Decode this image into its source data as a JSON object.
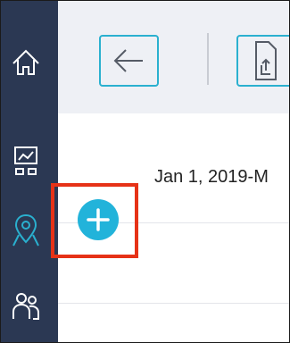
{
  "sidebar": {
    "items": [
      {
        "icon": "home-icon"
      },
      {
        "icon": "dashboard-icon"
      },
      {
        "icon": "location-icon",
        "active": true
      },
      {
        "icon": "users-icon"
      }
    ]
  },
  "toolbar": {
    "back_icon": "arrow-left-icon",
    "export_icon": "export-icon"
  },
  "content": {
    "date_range": "Jan 1, 2019-M"
  },
  "add_button": {
    "icon": "plus-icon"
  },
  "colors": {
    "sidebar_bg": "#2b3853",
    "accent": "#2ab0cf",
    "active_icon": "#2ab0cf",
    "add_button": "#22b3da",
    "highlight": "#e63217"
  }
}
